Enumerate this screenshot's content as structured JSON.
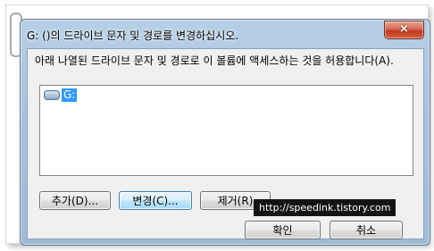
{
  "dialog": {
    "title": "G: ()의 드라이브 문자 및 경로를 변경하십시오.",
    "instruction": "아래 나열된 드라이브 문자 및 경로로 이 볼륨에 액세스하는 것을 허용합니다(A).",
    "list_items": [
      {
        "label": "G:",
        "icon": "drive-icon",
        "selected": true
      }
    ],
    "buttons": {
      "add": "추가(D)...",
      "change": "변경(C)...",
      "remove": "제거(R)",
      "ok": "확인",
      "cancel": "취소"
    },
    "close_icon": "×"
  },
  "watermark": "http://speedink.tistory.com",
  "colors": {
    "selection": "#3399ff",
    "close_button": "#c0391e",
    "frame": "#a8c3dd"
  }
}
